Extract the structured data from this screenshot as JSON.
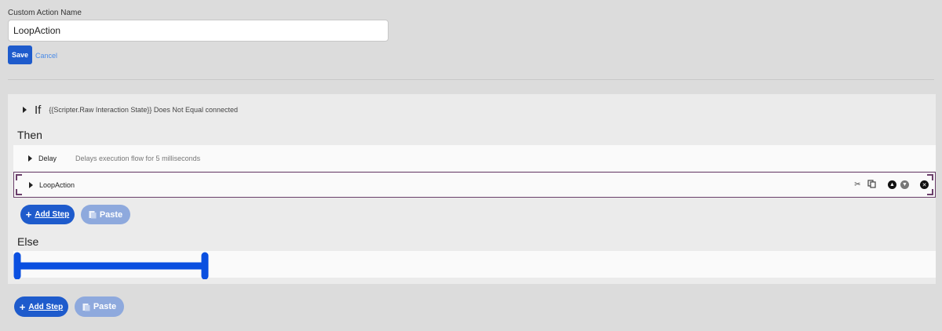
{
  "form": {
    "label": "Custom Action Name",
    "value": "LoopAction",
    "save_label": "Save",
    "cancel_label": "Cancel"
  },
  "if_block": {
    "keyword": "If",
    "condition": "{{Scripter.Raw Interaction State}} Does Not Equal connected",
    "then_label": "Then",
    "else_label": "Else"
  },
  "steps": [
    {
      "title": "Delay",
      "description": "Delays execution flow for 5 milliseconds"
    },
    {
      "title": "LoopAction",
      "description": ""
    }
  ],
  "toolbar": {
    "add_step_label": "Add Step",
    "paste_label": "Paste",
    "add_step_icon": "plus-icon",
    "paste_icon": "clipboard-icon"
  },
  "step_tools": [
    "scissors-icon",
    "copy-icon",
    "move-up-icon",
    "move-down-icon",
    "delete-icon"
  ],
  "colors": {
    "primary": "#1e5bcc",
    "primary_disabled": "#8ea9dd",
    "selected_border": "#6a3f6a",
    "redaction": "#0a4fe0"
  }
}
